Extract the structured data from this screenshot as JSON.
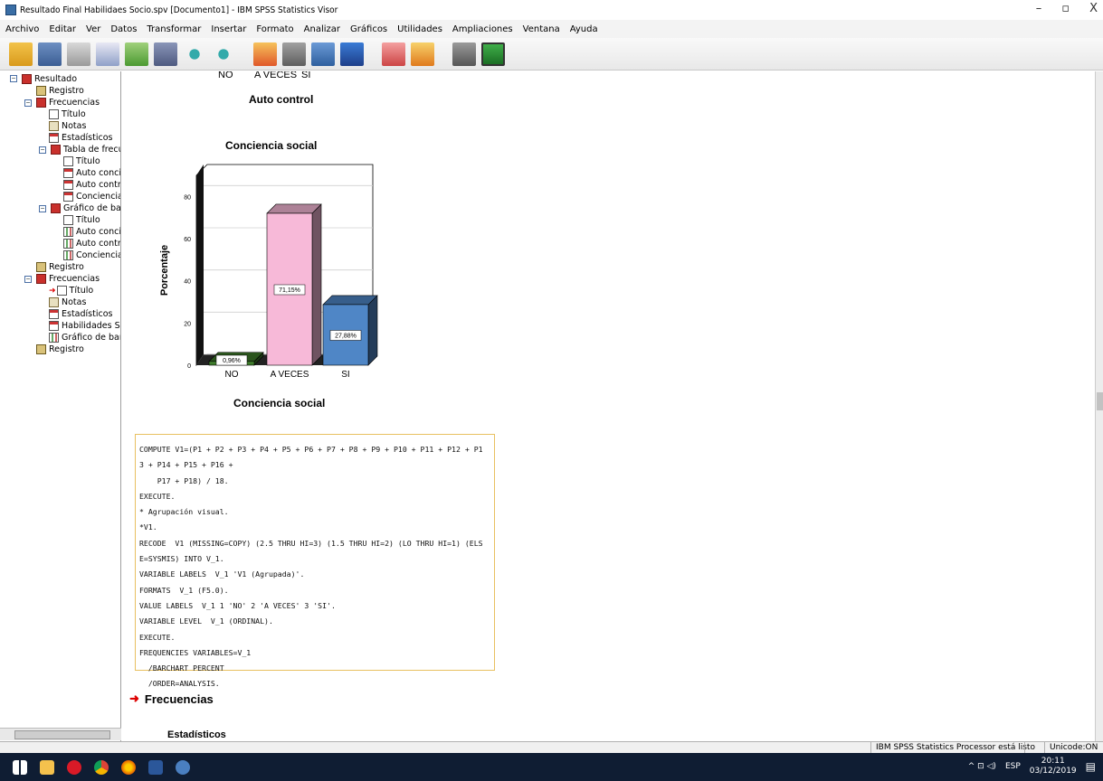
{
  "window": {
    "title": "Resultado Final Habilidaes Socio.spv [Documento1] - IBM SPSS Statistics Visor",
    "minimize": "–",
    "maximize": "▫",
    "close": "X"
  },
  "menu": [
    "Archivo",
    "Editar",
    "Ver",
    "Datos",
    "Transformar",
    "Insertar",
    "Formato",
    "Analizar",
    "Gráficos",
    "Utilidades",
    "Ampliaciones",
    "Ventana",
    "Ayuda"
  ],
  "tree": [
    {
      "label": "Resultado",
      "icon": "book-icon"
    },
    {
      "label": "Registro",
      "icon": "log-icon"
    },
    {
      "label": "Frecuencias",
      "icon": "book-icon"
    },
    {
      "label": "Título",
      "icon": "title-icon"
    },
    {
      "label": "Notas",
      "icon": "note-icon"
    },
    {
      "label": "Estadísticos",
      "icon": "table-icon"
    },
    {
      "label": "Tabla de frecuenc",
      "icon": "book-icon"
    },
    {
      "label": "Título",
      "icon": "title-icon"
    },
    {
      "label": "Auto concien",
      "icon": "table-icon"
    },
    {
      "label": "Auto control",
      "icon": "table-icon"
    },
    {
      "label": "Conciencia s",
      "icon": "table-icon"
    },
    {
      "label": "Gráfico de barras",
      "icon": "book-icon"
    },
    {
      "label": "Título",
      "icon": "title-icon"
    },
    {
      "label": "Auto concien",
      "icon": "chart-icon"
    },
    {
      "label": "Auto control",
      "icon": "chart-icon"
    },
    {
      "label": "Conciencia s",
      "icon": "chart-icon"
    },
    {
      "label": "Registro",
      "icon": "log-icon"
    },
    {
      "label": "Frecuencias",
      "icon": "book-icon"
    },
    {
      "label": "Título",
      "icon": "title-icon"
    },
    {
      "label": "Notas",
      "icon": "note-icon"
    },
    {
      "label": "Estadísticos",
      "icon": "table-icon"
    },
    {
      "label": "Habilidades Socic",
      "icon": "table-icon"
    },
    {
      "label": "Gráfico de barras",
      "icon": "chart-icon"
    },
    {
      "label": "Registro",
      "icon": "log-icon"
    }
  ],
  "prev_chart": {
    "tick_labels": [
      "NO",
      "A VECES",
      "SI"
    ],
    "xlabel": "Auto control"
  },
  "chart_data": {
    "type": "bar",
    "title": "Conciencia social",
    "xlabel": "Conciencia social",
    "ylabel": "Porcentaje",
    "categories": [
      "NO",
      "A VECES",
      "SI"
    ],
    "values": [
      0.96,
      71.15,
      27.88
    ],
    "value_labels": [
      "0,96%",
      "71,15%",
      "27,88%"
    ],
    "yticks": [
      0,
      20,
      40,
      60,
      80
    ],
    "ylim": [
      0,
      90
    ],
    "colors": [
      "#3d7a2a",
      "#f7b9d8",
      "#4f86c6"
    ],
    "grid": true
  },
  "syntax": [
    "COMPUTE V1=(P1 + P2 + P3 + P4 + P5 + P6 + P7 + P8 + P9 + P10 + P11 + P12 + P1",
    "3 + P14 + P15 + P16 +",
    "    P17 + P18) / 18.",
    "EXECUTE.",
    "* Agrupación visual.",
    "*V1.",
    "RECODE  V1 (MISSING=COPY) (2.5 THRU HI=3) (1.5 THRU HI=2) (LO THRU HI=1) (ELS",
    "E=SYSMIS) INTO V_1.",
    "VARIABLE LABELS  V_1 'V1 (Agrupada)'.",
    "FORMATS  V_1 (F5.0).",
    "VALUE LABELS  V_1 1 'NO' 2 'A VECES' 3 'SI'.",
    "VARIABLE LEVEL  V_1 (ORDINAL).",
    "EXECUTE.",
    "FREQUENCIES VARIABLES=V_1",
    "  /BARCHART PERCENT",
    "  /ORDER=ANALYSIS."
  ],
  "section": {
    "title": "Frecuencias",
    "subtitle": "Estadísticos"
  },
  "status": {
    "message": "IBM SPSS Statistics Processor está listo",
    "unicode": "Unicode:ON"
  },
  "taskbar": {
    "lang": "ESP",
    "time": "20:11",
    "date": "03/12/2019"
  }
}
